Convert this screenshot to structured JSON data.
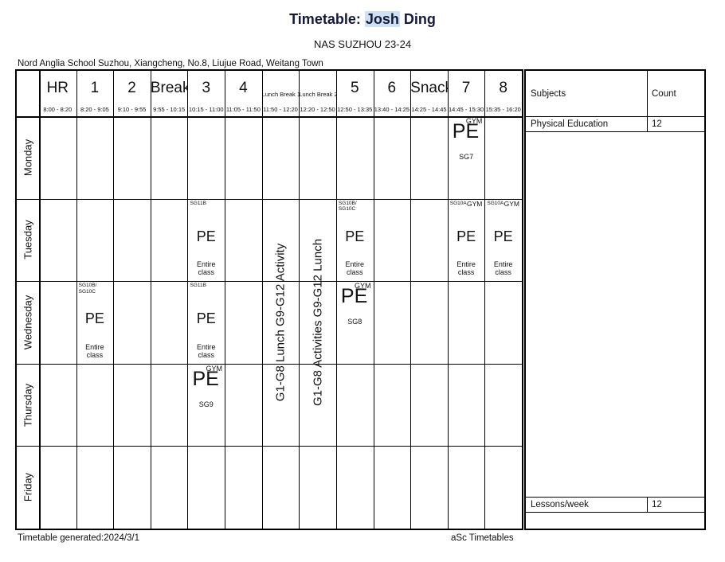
{
  "title": {
    "prefix": "Timetable: ",
    "highlight": "Josh",
    "suffix": " Ding"
  },
  "subtitle": "NAS SUZHOU 23-24",
  "address": "Nord Anglia School Suzhou, Xiangcheng, No.8, Liujue Road, Weitang Town",
  "periods": [
    {
      "name": "HR",
      "time": "8:00 - 8:20",
      "small": false
    },
    {
      "name": "1",
      "time": "8:20 - 9:05",
      "small": false
    },
    {
      "name": "2",
      "time": "9:10 - 9:55",
      "small": false
    },
    {
      "name": "Break",
      "time": "9:55 - 10:15",
      "small": false
    },
    {
      "name": "3",
      "time": "10:15 - 11:00",
      "small": false
    },
    {
      "name": "4",
      "time": "11:05 - 11:50",
      "small": false
    },
    {
      "name": "Lunch Break 1",
      "time": "11:50 - 12:20",
      "small": true
    },
    {
      "name": "Lunch Break 2",
      "time": "12:20 - 12:50",
      "small": true
    },
    {
      "name": "5",
      "time": "12:50 - 13:35",
      "small": false
    },
    {
      "name": "6",
      "time": "13:40 - 14:25",
      "small": false
    },
    {
      "name": "Snack",
      "time": "14:25 - 14:45",
      "small": false
    },
    {
      "name": "7",
      "time": "14:45 - 15:30",
      "small": false
    },
    {
      "name": "8",
      "time": "15:35 - 16:20",
      "small": false
    }
  ],
  "days": [
    "Monday",
    "Tuesday",
    "Wednesday",
    "Thursday",
    "Friday"
  ],
  "vertical_columns": {
    "lunch1": "G1-G8 Lunch  G9-G12 Activity",
    "lunch2": "G1-G8 Activities  G9-G12 Lunch"
  },
  "lessons": [
    {
      "day": "Monday",
      "period": "7",
      "subject": "PE",
      "room": "GYM",
      "group": "SG7",
      "class": "",
      "style": "big"
    },
    {
      "day": "Tuesday",
      "period": "3",
      "subject": "PE",
      "room": "",
      "group": "",
      "class": "Entire class",
      "sg": "SG11B",
      "style": "mid"
    },
    {
      "day": "Tuesday",
      "period": "5",
      "subject": "PE",
      "room": "",
      "group": "",
      "class": "Entire class",
      "sg": "SG10B/\nSG10C",
      "style": "mid"
    },
    {
      "day": "Tuesday",
      "period": "7",
      "subject": "PE",
      "room": "GYM",
      "group": "",
      "class": "Entire class",
      "sg": "SG10A",
      "style": "mid"
    },
    {
      "day": "Tuesday",
      "period": "8",
      "subject": "PE",
      "room": "GYM",
      "group": "",
      "class": "Entire class",
      "sg": "SG10A",
      "style": "mid"
    },
    {
      "day": "Wednesday",
      "period": "1",
      "subject": "PE",
      "room": "",
      "group": "",
      "class": "Entire class",
      "sg": "SG10B/\nSG10C",
      "style": "mid"
    },
    {
      "day": "Wednesday",
      "period": "3",
      "subject": "PE",
      "room": "",
      "group": "",
      "class": "Entire class",
      "sg": "SG11B",
      "style": "mid"
    },
    {
      "day": "Wednesday",
      "period": "5",
      "subject": "PE",
      "room": "GYM",
      "group": "SG8",
      "class": "",
      "style": "big"
    },
    {
      "day": "Thursday",
      "period": "3",
      "subject": "PE",
      "room": "GYM",
      "group": "SG9",
      "class": "",
      "style": "big"
    }
  ],
  "subjects_panel": {
    "header_subject": "Subjects",
    "header_count": "Count",
    "rows": [
      {
        "subject": "Physical Education",
        "count": "12"
      }
    ],
    "total_label": "Lessons/week",
    "total_count": "12"
  },
  "footer": {
    "left": "Timetable generated:2024/3/1",
    "right": "aSc Timetables"
  },
  "colors": {
    "title": "#151a38",
    "highlight": "#cfe0f5",
    "border": "#000000",
    "background": "#ffffff"
  }
}
